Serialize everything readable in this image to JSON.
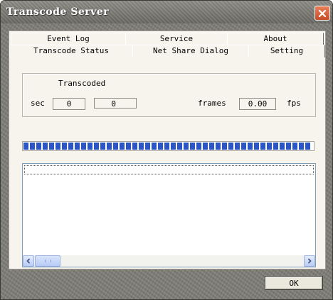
{
  "window": {
    "title": "Transcode Server"
  },
  "tabs": {
    "back_row": [
      "Event Log",
      "Service",
      "About"
    ],
    "front_row": [
      "Transcode Status",
      "Net Share Dialog",
      "Setting"
    ],
    "active": "Transcode Status"
  },
  "status_group": {
    "title": "Transcoded",
    "sec_label": "sec",
    "sec_value_1": "0",
    "sec_value_2": "0",
    "frames_label": "frames",
    "fps_value": "0.00",
    "fps_label": "fps"
  },
  "progress": {
    "fraction": 1.0,
    "color": "#2b55c6"
  },
  "list": {
    "items": []
  },
  "buttons": {
    "ok_label": "OK"
  },
  "colors": {
    "close_button": "#d9572f",
    "panel": "#f6f4ec",
    "frame": "#7c7b74"
  }
}
